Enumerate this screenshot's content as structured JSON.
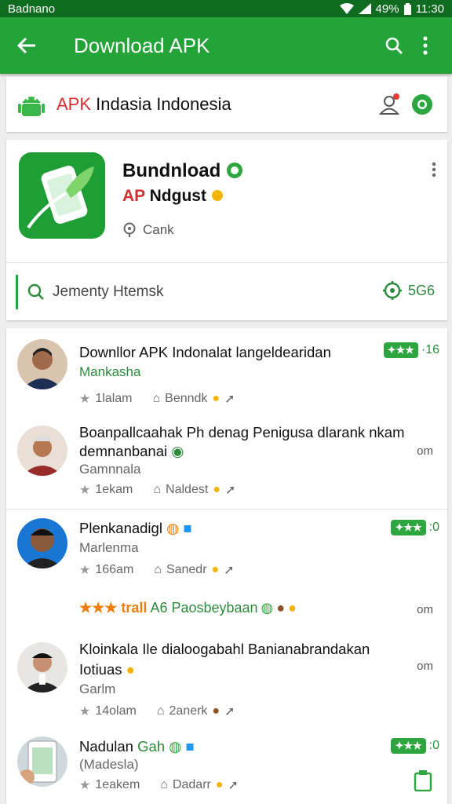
{
  "status": {
    "carrier": "Badnano",
    "battery": "49%",
    "time": "11:30"
  },
  "appbar": {
    "title": "Download APK",
    "back_icon": "arrow-left-icon",
    "search_icon": "search-icon",
    "menu_icon": "more-vert-icon"
  },
  "brand": {
    "apk": "APK",
    "name": "Indasia Indonesia"
  },
  "app": {
    "title": "Bundnload",
    "ap": "AP",
    "subtitle": "Ndgust",
    "location": "Cank",
    "search_placeholder": "Jementy Htemsk",
    "count": "5G6"
  },
  "list": [
    {
      "title": "Downllor APK Indonalat langeldearidan",
      "subtitle": "Mankasha",
      "meta1": "1lalam",
      "meta2": "Benndk",
      "badge": "·16"
    },
    {
      "title": "Boanpallcaahak Ph denag Penigusa dlarank nkam",
      "title2": "demnanbanai",
      "subtitle": "Gamnnala",
      "meta1": "1ekam",
      "meta2": "Naldest",
      "side": "om"
    },
    {
      "title": "Plenkanadigl",
      "subtitle": "Marlenma",
      "meta1": "166am",
      "meta2": "Sanedr",
      "badge": ":0"
    },
    {
      "promo_stars": "★★★ trall",
      "promo_text": "A6 Paosbeybaan",
      "side": "om"
    },
    {
      "title": "Kloinkala Ile dialoogabahl Banianabrandakan",
      "title2": "Iotiuas",
      "subtitle": "Garlm",
      "meta1": "14olam",
      "meta2": "2anerk",
      "side": "om"
    },
    {
      "title": "Nadulan",
      "title_green": "Gah",
      "subtitle": "(Madesla)",
      "meta1": "1eakem",
      "meta2": "Dadarr",
      "badge": ":0"
    }
  ],
  "colors": {
    "primary": "#24a338",
    "dark": "#0f6b1f",
    "accent_red": "#d32f2f",
    "star": "#ef7d0b"
  }
}
